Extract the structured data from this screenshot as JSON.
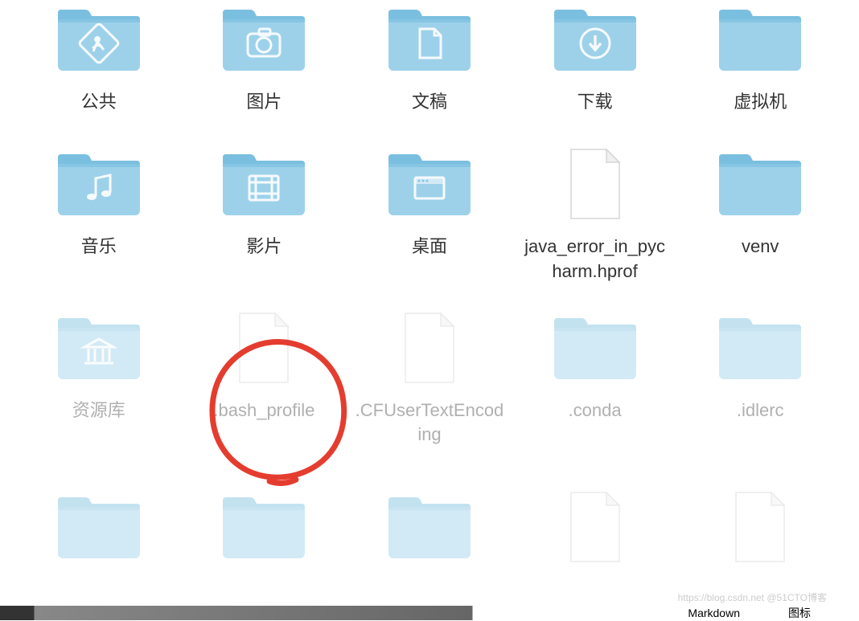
{
  "items": [
    {
      "type": "folder",
      "label": "公共",
      "iconGlyph": "public",
      "hidden": false
    },
    {
      "type": "folder",
      "label": "图片",
      "iconGlyph": "pictures",
      "hidden": false
    },
    {
      "type": "folder",
      "label": "文稿",
      "iconGlyph": "documents",
      "hidden": false
    },
    {
      "type": "folder",
      "label": "下载",
      "iconGlyph": "downloads",
      "hidden": false
    },
    {
      "type": "folder",
      "label": "虚拟机",
      "iconGlyph": "plain",
      "hidden": false
    },
    {
      "type": "folder",
      "label": "音乐",
      "iconGlyph": "music",
      "hidden": false
    },
    {
      "type": "folder",
      "label": "影片",
      "iconGlyph": "movies",
      "hidden": false
    },
    {
      "type": "folder",
      "label": "桌面",
      "iconGlyph": "desktop",
      "hidden": false
    },
    {
      "type": "file",
      "label": "java_error_in_pycharm.hprof",
      "iconGlyph": "blank-file",
      "hidden": false
    },
    {
      "type": "folder",
      "label": "venv",
      "iconGlyph": "plain",
      "hidden": false
    },
    {
      "type": "folder",
      "label": "资源库",
      "iconGlyph": "library",
      "hidden": true
    },
    {
      "type": "file",
      "label": ".bash_profile",
      "iconGlyph": "blank-file",
      "hidden": true,
      "circled": true
    },
    {
      "type": "file",
      "label": ".CFUserTextEncoding",
      "iconGlyph": "blank-file",
      "hidden": true
    },
    {
      "type": "folder",
      "label": ".conda",
      "iconGlyph": "plain",
      "hidden": true
    },
    {
      "type": "folder",
      "label": ".idlerc",
      "iconGlyph": "plain",
      "hidden": true
    },
    {
      "type": "folder",
      "label": "",
      "iconGlyph": "plain",
      "hidden": true,
      "partial": true
    },
    {
      "type": "folder",
      "label": "",
      "iconGlyph": "plain",
      "hidden": true,
      "partial": true
    },
    {
      "type": "folder",
      "label": "",
      "iconGlyph": "plain",
      "hidden": true,
      "partial": true
    },
    {
      "type": "file",
      "label": "",
      "iconGlyph": "blank-file",
      "hidden": true,
      "partial": true
    },
    {
      "type": "file",
      "label": "",
      "iconGlyph": "blank-file",
      "hidden": true,
      "partial": true
    }
  ],
  "annotation": {
    "circleColor": "#e43d2f",
    "circleStroke": 6
  },
  "watermark": "https://blog.csdn.net @51CTO博客",
  "bottomBarText1": "Markdown",
  "bottomBarText2": "图标"
}
